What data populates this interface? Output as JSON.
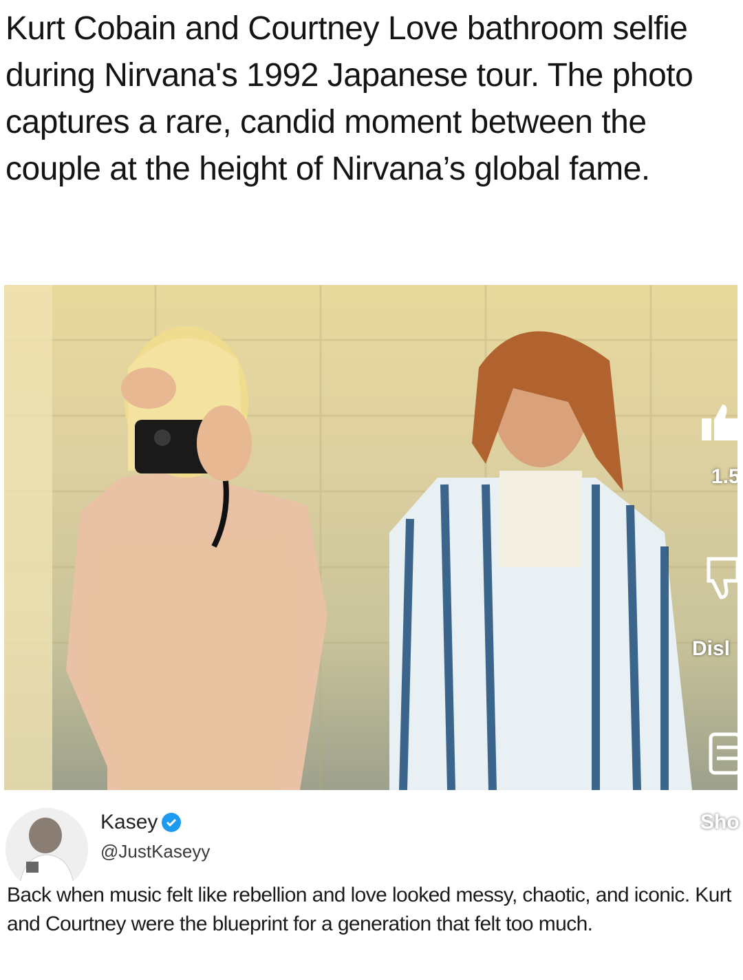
{
  "caption": "Kurt Cobain and Courtney Love bathroom selfie during Nirvana's 1992 Japanese tour. The photo captures a rare, candid moment between the couple at the height of Nirvana’s global fame.",
  "overlay": {
    "like_count": "1.5",
    "dislike_label": "Disl",
    "share_label": "Sho",
    "like_icon": "thumbs-up-icon",
    "dislike_icon": "thumbs-down-icon",
    "comment_icon": "comment-icon"
  },
  "post": {
    "author_name": "Kasey",
    "author_handle": "@JustKaseyy",
    "verified_color": "#1d9bf0",
    "text": "Back when music felt like rebellion and love looked messy, chaotic, and iconic. Kurt and Courtney were the blueprint for a generation that felt too much."
  }
}
